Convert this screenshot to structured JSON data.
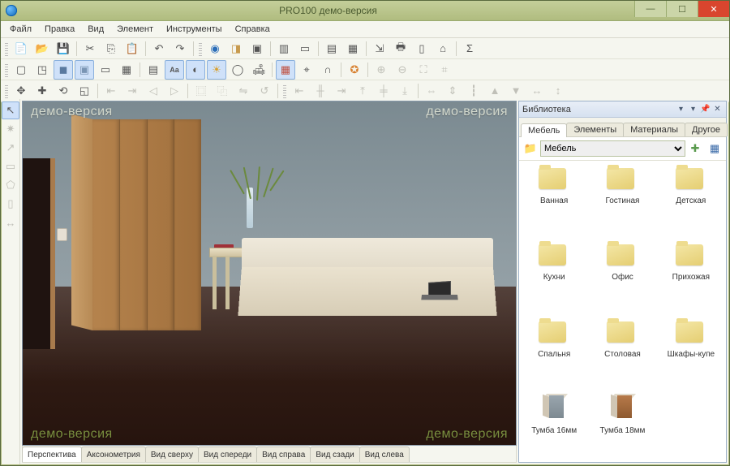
{
  "title": "PRO100 демо-версия",
  "menu": [
    "Файл",
    "Правка",
    "Вид",
    "Элемент",
    "Инструменты",
    "Справка"
  ],
  "watermark": "демо-версия",
  "viewtabs": [
    "Перспектива",
    "Аксонометрия",
    "Вид сверху",
    "Вид спереди",
    "Вид справа",
    "Вид сзади",
    "Вид слева"
  ],
  "library": {
    "title": "Библиотека",
    "tabs": [
      "Мебель",
      "Элементы",
      "Материалы",
      "Другое"
    ],
    "path": "Мебель",
    "items": [
      {
        "label": "Ванная",
        "type": "folder"
      },
      {
        "label": "Гостиная",
        "type": "folder"
      },
      {
        "label": "Детская",
        "type": "folder"
      },
      {
        "label": "Кухни",
        "type": "folder"
      },
      {
        "label": "Офис",
        "type": "folder"
      },
      {
        "label": "Прихожая",
        "type": "folder"
      },
      {
        "label": "Спальня",
        "type": "folder"
      },
      {
        "label": "Столовая",
        "type": "folder"
      },
      {
        "label": "Шкафы-купе",
        "type": "folder"
      },
      {
        "label": "Тумба 16мм",
        "type": "cab-a"
      },
      {
        "label": "Тумба 18мм",
        "type": "cab-b"
      }
    ]
  }
}
